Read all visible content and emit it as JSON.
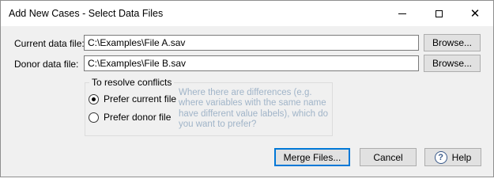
{
  "window": {
    "title": "Add New Cases - Select Data Files",
    "min_glyph": "",
    "max_glyph": "",
    "close_glyph": "✕"
  },
  "current_file": {
    "label": "Current data file:",
    "value": "C:\\Examples\\File A.sav",
    "browse_label": "Browse..."
  },
  "donor_file": {
    "label": "Donor data file:",
    "value": "C:\\Examples\\File B.sav",
    "browse_label": "Browse..."
  },
  "conflicts": {
    "title": "To resolve conflicts",
    "options": [
      {
        "label": "Prefer current file",
        "checked": true
      },
      {
        "label": "Prefer donor file",
        "checked": false
      }
    ],
    "help_text": "Where there are differences (e.g. where variables with the same name have different value labels), which do you want to prefer?"
  },
  "buttons": {
    "merge": "Merge Files...",
    "cancel": "Cancel",
    "help": "Help",
    "help_icon_glyph": "?"
  },
  "colors": {
    "help_text": "#a0b4c8",
    "default_button_border": "#0078d7"
  }
}
